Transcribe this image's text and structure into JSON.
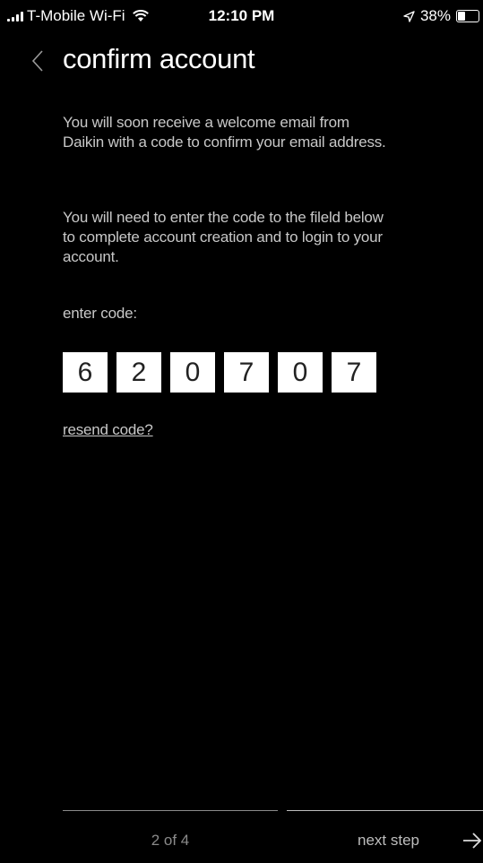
{
  "status_bar": {
    "carrier": "T-Mobile Wi-Fi",
    "time": "12:10 PM",
    "battery_percent": "38%",
    "battery_level": 0.38,
    "icons": [
      "signal-icon",
      "wifi-icon",
      "location-arrow-icon",
      "battery-icon"
    ]
  },
  "header": {
    "back_icon": "chevron-left-icon",
    "title": "confirm account"
  },
  "body": {
    "paragraph1": "You will soon receive a welcome email from Daikin with a code to confirm your email address.",
    "paragraph2": "You will need to enter the code to the fileld below to complete account creation and to login to your account.",
    "code_label": "enter code:",
    "code_digits": [
      "6",
      "2",
      "0",
      "7",
      "0",
      "7"
    ],
    "resend_link": "resend code?"
  },
  "footer": {
    "step_indicator": "2 of 4",
    "next_label": "next step",
    "next_icon": "arrow-right-icon"
  },
  "colors": {
    "background": "#000000",
    "text": "#ffffff",
    "muted_text": "#c8c8c8",
    "code_box": "#ffffff"
  }
}
